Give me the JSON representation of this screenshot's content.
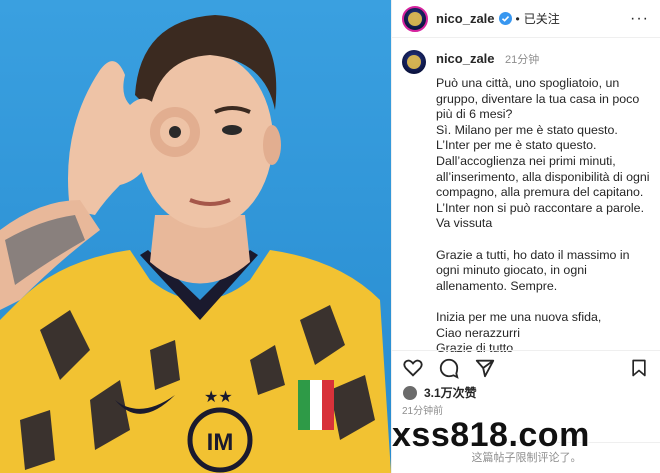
{
  "header": {
    "username": "nico_zale",
    "separator": "•",
    "follow_status": "已关注",
    "more": "···"
  },
  "caption": {
    "username": "nico_zale",
    "time": "21分钟",
    "text": "Può una città, uno spogliatoio, un gruppo, diventare la tua casa in poco più di 6 mesi?\nSì. Milano per me è stato questo.\nL’Inter per me è stato questo.\nDall’accoglienza nei primi minuti, all’inserimento, alla disponibilità di ogni compagno, alla premura del capitano.\nL’Inter non si può raccontare a parole. Va vissuta\n\nGrazie a tutti, ho dato il massimo in ogni minuto giocato, in ogni allenamento. Sempre.\n\nInizia per me una nuova sfida,\nCiao nerazzurri\nGrazie di tutto"
  },
  "stats": {
    "likes": "3.1万次赞",
    "time_ago": "21分钟前",
    "comments_limited": "这篇帖子限制评论了。"
  },
  "watermark": "xss818.com",
  "colors": {
    "photo_bg": "#3aa0e0",
    "jersey": "#f2c232",
    "verified": "#3897f0"
  }
}
